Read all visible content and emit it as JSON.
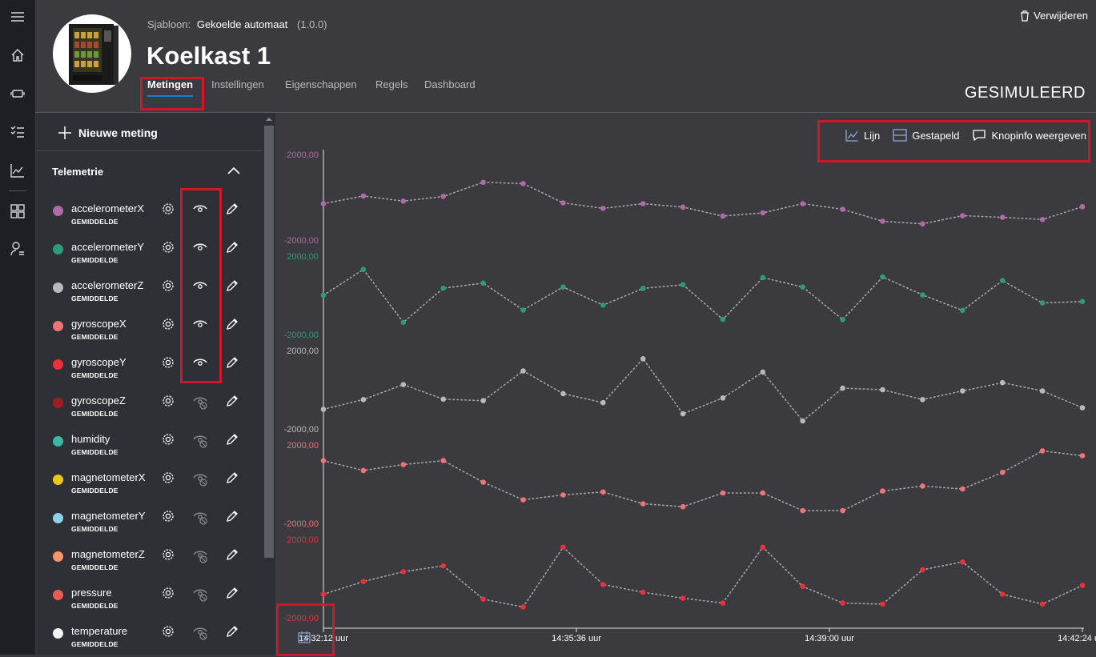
{
  "header": {
    "template_label": "Sjabloon:",
    "template_name": "Gekoelde automaat",
    "template_version": "(1.0.0)",
    "device_title": "Koelkast 1",
    "status": "GESIMULEERD",
    "delete_label": "Verwijderen",
    "tabs": [
      {
        "label": "Metingen",
        "active": true
      },
      {
        "label": "Instellingen"
      },
      {
        "label": "Eigenschappen"
      },
      {
        "label": "Regels"
      },
      {
        "label": "Dashboard"
      }
    ]
  },
  "rail_icons": [
    "menu-icon",
    "home-icon",
    "devices-icon",
    "tasks-icon",
    "analytics-icon",
    "dashboard-grid-icon",
    "user-icon"
  ],
  "panel": {
    "new_label": "Nieuwe meting",
    "section_label": "Telemetrie",
    "measurements": [
      {
        "name": "accelerometerX",
        "agg": "GEMIDDELDE",
        "color": "#b06aa5",
        "visible": true
      },
      {
        "name": "accelerometerY",
        "agg": "GEMIDDELDE",
        "color": "#2e9a7a",
        "visible": true
      },
      {
        "name": "accelerometerZ",
        "agg": "GEMIDDELDE",
        "color": "#b9b9b9",
        "visible": true
      },
      {
        "name": "gyroscopeX",
        "agg": "GEMIDDELDE",
        "color": "#f07378",
        "visible": true
      },
      {
        "name": "gyroscopeY",
        "agg": "GEMIDDELDE",
        "color": "#e8313b",
        "visible": true
      },
      {
        "name": "gyroscopeZ",
        "agg": "GEMIDDELDE",
        "color": "#a11c22",
        "visible": false
      },
      {
        "name": "humidity",
        "agg": "GEMIDDELDE",
        "color": "#3bb7a3",
        "visible": false
      },
      {
        "name": "magnetometerX",
        "agg": "GEMIDDELDE",
        "color": "#ecc71a",
        "visible": false
      },
      {
        "name": "magnetometerY",
        "agg": "GEMIDDELDE",
        "color": "#8fd0ee",
        "visible": false
      },
      {
        "name": "magnetometerZ",
        "agg": "GEMIDDELDE",
        "color": "#f5956a",
        "visible": false
      },
      {
        "name": "pressure",
        "agg": "GEMIDDELDE",
        "color": "#ec5a58",
        "visible": false
      },
      {
        "name": "temperature",
        "agg": "GEMIDDELDE",
        "color": "#f5f5f5",
        "visible": false
      }
    ]
  },
  "toolbar": {
    "line_label": "Lijn",
    "stacked_label": "Gestapeld",
    "tooltip_label": "Knopinfo weergeven"
  },
  "chart_data": {
    "type": "line",
    "layout": "stacked",
    "x": [
      "14:32:12",
      "14:33:08",
      "14:34:05",
      "14:35:01",
      "14:35:36",
      "14:36:09",
      "14:37:00",
      "14:37:30",
      "14:38:04",
      "14:38:40",
      "14:39:00",
      "14:39:45",
      "14:40:30",
      "14:41:15",
      "14:42:24"
    ],
    "x_ticks": [
      "14:32:12 uur",
      "14:35:36 uur",
      "14:39:00 uur",
      "14:42:24 uur"
    ],
    "ylim": [
      -2000,
      2000
    ],
    "y_tick_labels": [
      "2000,00",
      "-2000,00"
    ],
    "series": [
      {
        "name": "accelerometerX",
        "color": "#b06aa5",
        "values": [
          -300,
          60,
          -180,
          40,
          700,
          640,
          -260,
          -520,
          -300,
          -460,
          -880,
          -730,
          -300,
          -560,
          -1120,
          -1240,
          -860,
          -940,
          -1040,
          -440
        ]
      },
      {
        "name": "accelerometerY",
        "color": "#2e9a7a",
        "values": [
          0,
          1320,
          -1380,
          360,
          620,
          -750,
          420,
          -500,
          350,
          540,
          -1230,
          900,
          420,
          -1240,
          940,
          20,
          -770,
          750,
          -390,
          -320
        ]
      },
      {
        "name": "accelerometerZ",
        "color": "#b9b9b9",
        "values": [
          -1000,
          -500,
          260,
          -480,
          -560,
          960,
          -200,
          -660,
          1580,
          -1230,
          -420,
          900,
          -1590,
          80,
          0,
          -500,
          -60,
          360,
          -60,
          -920
        ]
      },
      {
        "name": "gyroscopeX",
        "color": "#f07378",
        "values": [
          1200,
          700,
          1000,
          1200,
          100,
          -800,
          -550,
          -400,
          -1000,
          -1150,
          -450,
          -450,
          -1350,
          -1350,
          -350,
          -100,
          -250,
          600,
          1700,
          1450
        ]
      },
      {
        "name": "gyroscopeY",
        "color": "#e8313b",
        "values": [
          -800,
          -150,
          350,
          650,
          -1050,
          -1450,
          1600,
          -300,
          -700,
          -1000,
          -1250,
          1600,
          -400,
          -1250,
          -1300,
          450,
          850,
          -800,
          -1300,
          -350
        ]
      }
    ]
  }
}
